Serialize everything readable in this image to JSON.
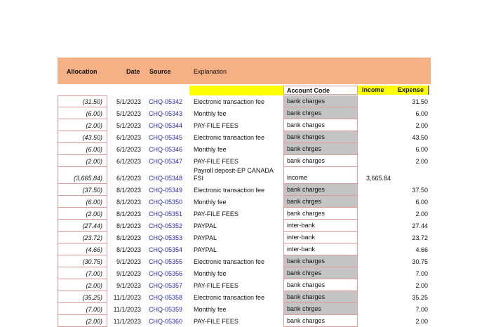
{
  "headers": {
    "allocation": "Allocation",
    "date": "Date",
    "source": "Source",
    "explanation": "Explanation",
    "account_code": "Account Code",
    "income": "Income",
    "expense": "Expense"
  },
  "rows": [
    {
      "allocation": "(31.50)",
      "date": "5/1/2023",
      "source": "CHQ-05342",
      "explanation": "Electronic transaction fee",
      "code": "bank charges",
      "shaded": true,
      "income": "",
      "expense": "31.50"
    },
    {
      "allocation": "(6.00)",
      "date": "5/1/2023",
      "source": "CHQ-05343",
      "explanation": "Monthly fee",
      "code": "bank chrges",
      "shaded": true,
      "income": "",
      "expense": "6.00"
    },
    {
      "allocation": "(2.00)",
      "date": "5/1/2023",
      "source": "CHQ-05344",
      "explanation": "PAY-FILE FEES",
      "code": "bank charges",
      "shaded": false,
      "income": "",
      "expense": "2.00"
    },
    {
      "allocation": "(43.50)",
      "date": "6/1/2023",
      "source": "CHQ-05345",
      "explanation": "Electronic transaction fee",
      "code": "bank charges",
      "shaded": true,
      "income": "",
      "expense": "43.50"
    },
    {
      "allocation": "(6.00)",
      "date": "6/1/2023",
      "source": "CHQ-05346",
      "explanation": "Monthly fee",
      "code": "bank chrges",
      "shaded": true,
      "income": "",
      "expense": "6.00"
    },
    {
      "allocation": "(2.00)",
      "date": "6/1/2023",
      "source": "CHQ-05347",
      "explanation": "PAY-FILE FEES",
      "code": "bank charges",
      "shaded": false,
      "income": "",
      "expense": "2.00"
    },
    {
      "allocation": "(3,665.84)",
      "date": "6/1/2023",
      "source": "CHQ-05348",
      "explanation_line1": "Payroll deposit-EP CANADA",
      "explanation_line2": "FSI",
      "code": "income",
      "shaded": false,
      "income": "3,665.84",
      "expense": "",
      "tall": true
    },
    {
      "allocation": "(37.50)",
      "date": "8/1/2023",
      "source": "CHQ-05349",
      "explanation": "Electronic transaction fee",
      "code": "bank charges",
      "shaded": true,
      "income": "",
      "expense": "37.50"
    },
    {
      "allocation": "(6.00)",
      "date": "8/1/2023",
      "source": "CHQ-05350",
      "explanation": "Monthly fee",
      "code": "bank chrges",
      "shaded": true,
      "income": "",
      "expense": "6.00"
    },
    {
      "allocation": "(2.00)",
      "date": "8/1/2023",
      "source": "CHQ-05351",
      "explanation": "PAY-FILE FEES",
      "code": "bank charges",
      "shaded": false,
      "income": "",
      "expense": "2.00"
    },
    {
      "allocation": "(27.44)",
      "date": "8/1/2023",
      "source": "CHQ-05352",
      "explanation": "PAYPAL",
      "code": "inter-bank",
      "shaded": false,
      "income": "",
      "expense": "27.44"
    },
    {
      "allocation": "(23.72)",
      "date": "8/1/2023",
      "source": "CHQ-05353",
      "explanation": "PAYPAL",
      "code": "inter-bank",
      "shaded": false,
      "income": "",
      "expense": "23.72"
    },
    {
      "allocation": "(4.66)",
      "date": "8/1/2023",
      "source": "CHQ-05354",
      "explanation": "PAYPAL",
      "code": "inter-bank",
      "shaded": false,
      "income": "",
      "expense": "4.66"
    },
    {
      "allocation": "(30.75)",
      "date": "9/1/2023",
      "source": "CHQ-05355",
      "explanation": "Electronic transaction fee",
      "code": "bank charges",
      "shaded": true,
      "income": "",
      "expense": "30.75"
    },
    {
      "allocation": "(7.00)",
      "date": "9/1/2023",
      "source": "CHQ-05356",
      "explanation": "Monthly fee",
      "code": "bank chrges",
      "shaded": true,
      "income": "",
      "expense": "7.00"
    },
    {
      "allocation": "(2.00)",
      "date": "9/1/2023",
      "source": "CHQ-05357",
      "explanation": "PAY-FILE FEES",
      "code": "bank charges",
      "shaded": false,
      "income": "",
      "expense": "2.00"
    },
    {
      "allocation": "(35.25)",
      "date": "11/1/2023",
      "source": "CHQ-05358",
      "explanation": "Electronic transaction fee",
      "code": "bank charges",
      "shaded": true,
      "income": "",
      "expense": "35.25"
    },
    {
      "allocation": "(7.00)",
      "date": "11/1/2023",
      "source": "CHQ-05359",
      "explanation": "Monthly fee",
      "code": "bank chrges",
      "shaded": true,
      "income": "",
      "expense": "7.00"
    },
    {
      "allocation": "(2.00)",
      "date": "11/1/2023",
      "source": "CHQ-05360",
      "explanation": "PAY-FILE FEES",
      "code": "bank charges",
      "shaded": false,
      "income": "",
      "expense": "2.00"
    }
  ]
}
